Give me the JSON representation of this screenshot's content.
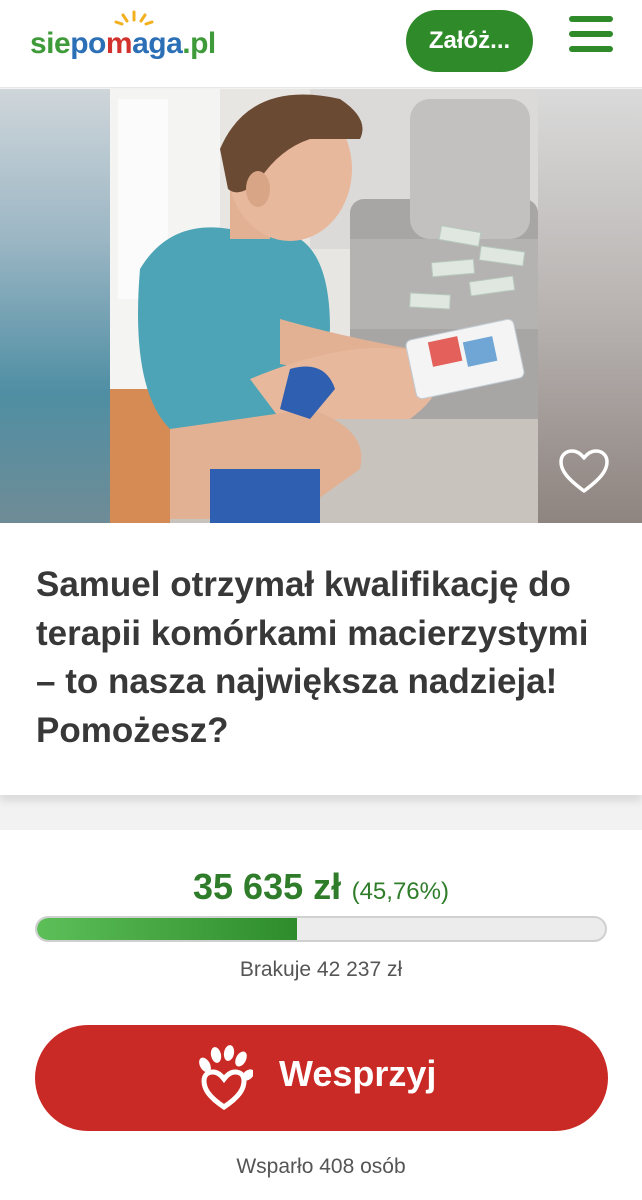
{
  "header": {
    "logo": {
      "part1": "sie",
      "part2": "po",
      "part3": "m",
      "part4": "aga",
      "part5": ".pl"
    },
    "create_button": "Załóż...",
    "menu_icon": "hamburger-menu-icon"
  },
  "campaign": {
    "title": "Samuel otrzymał kwalifikację do terapii komórkami macierzystymi – to nasza największa nadzieja! Pomożesz?",
    "favorite_icon": "heart-outline-icon"
  },
  "donation": {
    "amount": "35 635 zł",
    "percent_text": "(45,76%)",
    "progress_fraction": 0.4576,
    "missing": "Brakuje 42 237 zł",
    "support_button": "Wesprzyj",
    "support_icon": "helping-hands-heart-icon",
    "supporters": "Wsparło 408 osób"
  },
  "colors": {
    "brand_green": "#2f8a2a",
    "accent_red": "#c92a25"
  }
}
